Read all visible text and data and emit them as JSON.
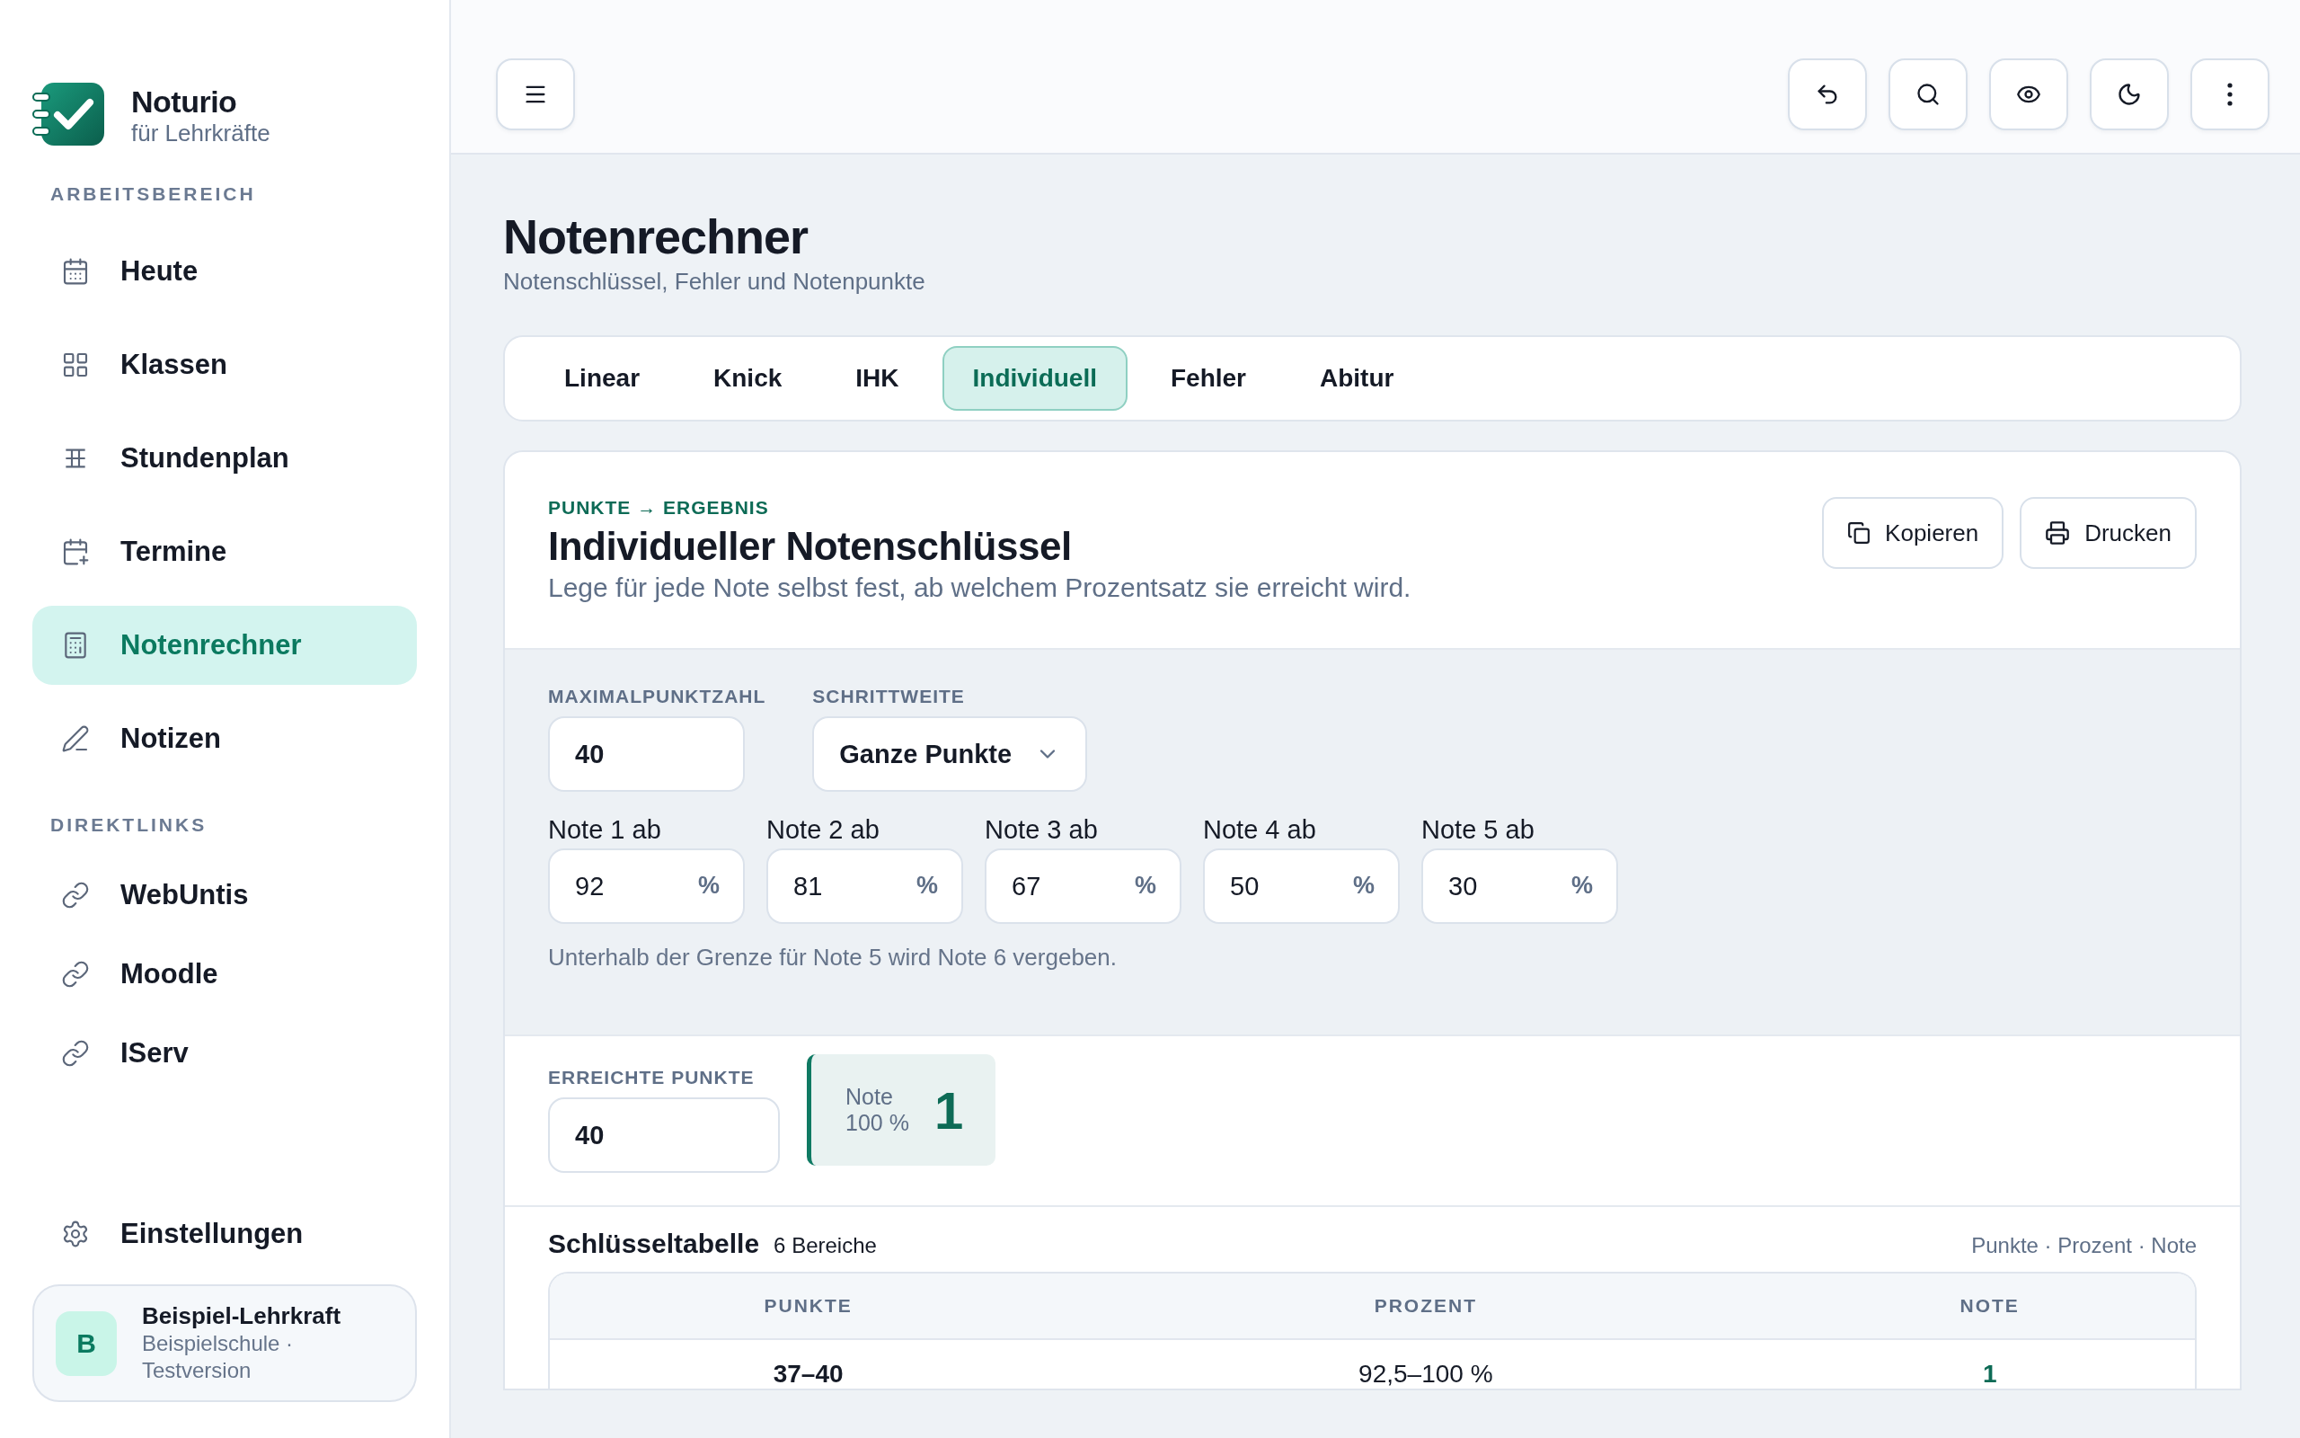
{
  "brand": {
    "name": "Noturio",
    "tagline": "für Lehrkräfte"
  },
  "sidebar": {
    "sections": [
      {
        "heading": "ARBEITSBEREICH",
        "items": [
          {
            "kind": "calendar",
            "label": "Heute",
            "selected": false
          },
          {
            "kind": "grid",
            "label": "Klassen",
            "selected": false
          },
          {
            "kind": "timetable",
            "label": "Stundenplan",
            "selected": false
          },
          {
            "kind": "calendar-plus",
            "label": "Termine",
            "selected": false
          },
          {
            "kind": "calculator",
            "label": "Notenrechner",
            "selected": true
          },
          {
            "kind": "pen",
            "label": "Notizen",
            "selected": false
          }
        ]
      },
      {
        "heading": "DIREKTLINKS",
        "items": [
          {
            "kind": "link",
            "label": "WebUntis",
            "selected": false
          },
          {
            "kind": "link",
            "label": "Moodle",
            "selected": false
          },
          {
            "kind": "link",
            "label": "IServ",
            "selected": false
          }
        ]
      }
    ],
    "footer_item": {
      "kind": "settings",
      "label": "Einstellungen",
      "selected": false
    },
    "user": {
      "initial": "B",
      "name": "Beispiel-Lehrkraft",
      "detail": "Beispielschule · Testversion"
    }
  },
  "toolbar": {
    "left": [
      {
        "kind": "menu"
      }
    ],
    "right": [
      {
        "kind": "undo"
      },
      {
        "kind": "search"
      },
      {
        "kind": "eye"
      },
      {
        "kind": "moon"
      },
      {
        "kind": "more"
      }
    ]
  },
  "page": {
    "title": "Notenrechner",
    "subtitle": "Notenschlüssel, Fehler und Notenpunkte"
  },
  "tabs": [
    {
      "label": "Linear",
      "selected": false
    },
    {
      "label": "Knick",
      "selected": false
    },
    {
      "label": "IHK",
      "selected": false
    },
    {
      "label": "Individuell",
      "selected": true
    },
    {
      "label": "Fehler",
      "selected": false
    },
    {
      "label": "Abitur",
      "selected": false
    }
  ],
  "card": {
    "eyebrow": "PUNKTE → ERGEBNIS",
    "title": "Individueller Notenschlüssel",
    "description": "Lege für jede Note selbst fest, ab welchem Prozentsatz sie erreicht wird.",
    "actions": [
      {
        "kind": "copy",
        "label": "Kopieren"
      },
      {
        "kind": "print",
        "label": "Drucken"
      }
    ],
    "settings": {
      "max_points": {
        "label": "MAXIMALPUNKTZAHL",
        "value": "40"
      },
      "step": {
        "label": "SCHRITTWEITE",
        "value": "Ganze Punkte"
      },
      "thresholds": [
        {
          "label": "Note 1 ab",
          "value": "92",
          "unit": "%"
        },
        {
          "label": "Note 2 ab",
          "value": "81",
          "unit": "%"
        },
        {
          "label": "Note 3 ab",
          "value": "67",
          "unit": "%"
        },
        {
          "label": "Note 4 ab",
          "value": "50",
          "unit": "%"
        },
        {
          "label": "Note 5 ab",
          "value": "30",
          "unit": "%"
        }
      ],
      "hint": "Unterhalb der Grenze für Note 5 wird Note 6 vergeben."
    },
    "result": {
      "points": {
        "label": "ERREICHTE PUNKTE",
        "value": "40"
      },
      "grade_label": "Note",
      "percent": "100 %",
      "grade": "1"
    },
    "key_table": {
      "title": "Schlüsseltabelle",
      "count": "6 Bereiche",
      "legend": "Punkte · Prozent · Note",
      "columns": [
        "PUNKTE",
        "PROZENT",
        "NOTE"
      ],
      "rows": [
        [
          "37–40",
          "92,5–100 %",
          "1"
        ]
      ]
    }
  }
}
